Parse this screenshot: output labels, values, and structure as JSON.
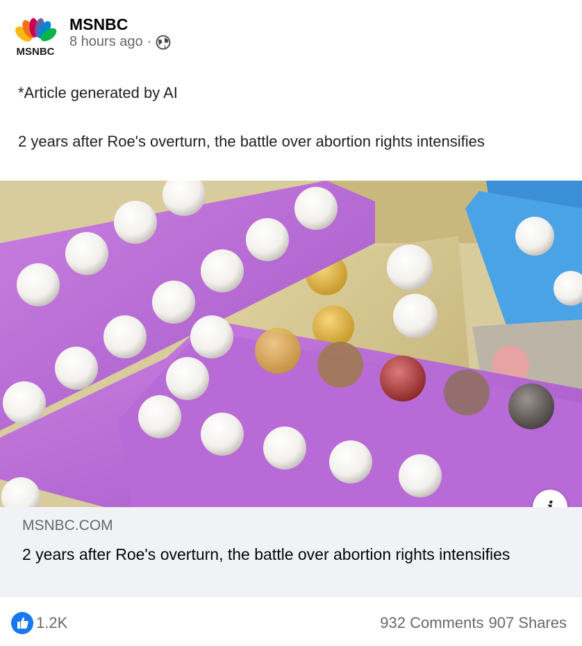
{
  "post": {
    "page_name": "MSNBC",
    "time": "8 hours ago",
    "separator": "·",
    "privacy_icon": "globe-icon",
    "text_line1": "*Article generated by AI",
    "text_line2": "2 years after Roe's overturn, the battle over abortion rights intensifies"
  },
  "logo": {
    "text": "MSNBC",
    "icon": "msnbc-peacock-logo"
  },
  "link": {
    "domain": "MSNBC.COM",
    "title": "2 years after Roe's overturn, the battle over abortion rights intensifies",
    "info_icon": "i",
    "image_description_icon": "pill-blister-packs-photo"
  },
  "engagement": {
    "like_icon": "thumbs-up-icon",
    "likes": "1.2K",
    "comments": "932 Comments",
    "shares": "907 Shares"
  },
  "colors": {
    "facebook_blue": "#1877f2",
    "secondary_text": "#65676b",
    "link_bg": "#f0f2f5"
  }
}
